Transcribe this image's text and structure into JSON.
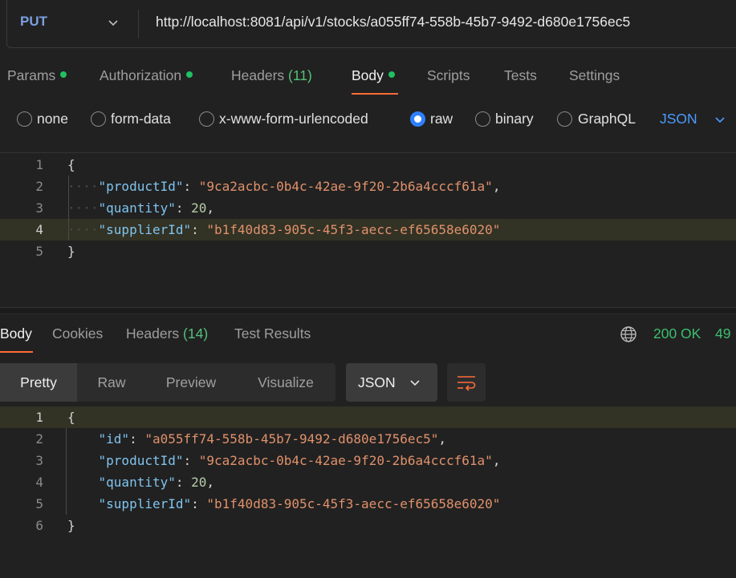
{
  "request": {
    "method": "PUT",
    "url": "http://localhost:8081/api/v1/stocks/a055ff74-558b-45b7-9492-d680e1756ec5"
  },
  "request_tabs": [
    {
      "label": "Params",
      "dot": true
    },
    {
      "label": "Authorization",
      "dot": true
    },
    {
      "label": "Headers",
      "count": "(11)"
    },
    {
      "label": "Body",
      "dot": true,
      "active": true
    },
    {
      "label": "Scripts"
    },
    {
      "label": "Tests"
    },
    {
      "label": "Settings"
    }
  ],
  "body_types": [
    {
      "label": "none",
      "checked": false
    },
    {
      "label": "form-data",
      "checked": false
    },
    {
      "label": "x-www-form-urlencoded",
      "checked": false
    },
    {
      "label": "raw",
      "checked": true
    },
    {
      "label": "binary",
      "checked": false
    },
    {
      "label": "GraphQL",
      "checked": false
    }
  ],
  "raw_format": "JSON",
  "request_body": {
    "line_numbers": [
      "1",
      "2",
      "3",
      "4",
      "5"
    ],
    "open_brace": "{",
    "close_brace": "}",
    "fields": [
      {
        "key": "\"productId\"",
        "value": "\"9ca2acbc-0b4c-42ae-9f20-2b6a4cccf61a\"",
        "type": "string",
        "comma": ","
      },
      {
        "key": "\"quantity\"",
        "value": "20",
        "type": "number",
        "comma": ","
      },
      {
        "key": "\"supplierId\"",
        "value": "\"b1f40d83-905c-45f3-aecc-ef65658e6020\"",
        "type": "string",
        "comma": ""
      }
    ]
  },
  "response_tabs": [
    {
      "label": "Body",
      "active": true
    },
    {
      "label": "Cookies"
    },
    {
      "label": "Headers",
      "count": "(14)"
    },
    {
      "label": "Test Results"
    }
  ],
  "response_status": "200 OK",
  "response_time": "49",
  "view_modes": [
    {
      "label": "Pretty",
      "active": true
    },
    {
      "label": "Raw"
    },
    {
      "label": "Preview"
    },
    {
      "label": "Visualize"
    }
  ],
  "response_format": "JSON",
  "response_body": {
    "line_numbers": [
      "1",
      "2",
      "3",
      "4",
      "5",
      "6"
    ],
    "open_brace": "{",
    "close_brace": "}",
    "fields": [
      {
        "key": "\"id\"",
        "value": "\"a055ff74-558b-45b7-9492-d680e1756ec5\"",
        "type": "string",
        "comma": ","
      },
      {
        "key": "\"productId\"",
        "value": "\"9ca2acbc-0b4c-42ae-9f20-2b6a4cccf61a\"",
        "type": "string",
        "comma": ","
      },
      {
        "key": "\"quantity\"",
        "value": "20",
        "type": "number",
        "comma": ","
      },
      {
        "key": "\"supplierId\"",
        "value": "\"b1f40d83-905c-45f3-aecc-ef65658e6020\"",
        "type": "string",
        "comma": ""
      }
    ]
  },
  "colors": {
    "accent": "#ff6c37",
    "status_ok": "#3bbf6e",
    "radio_checked": "#2f80ff",
    "link_blue": "#4a9cff"
  },
  "icons": [
    "chevron-down-icon",
    "globe-icon",
    "wrap-lines-icon"
  ]
}
